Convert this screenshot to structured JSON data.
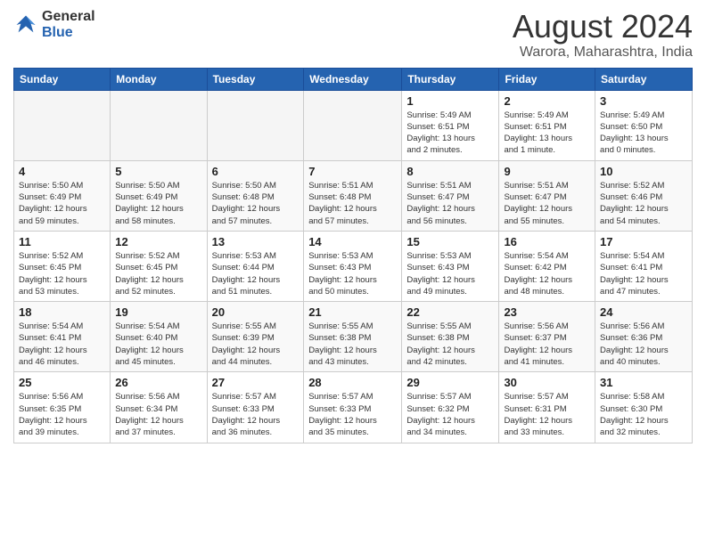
{
  "logo": {
    "line1": "General",
    "line2": "Blue"
  },
  "title": "August 2024",
  "subtitle": "Warora, Maharashtra, India",
  "days_of_week": [
    "Sunday",
    "Monday",
    "Tuesday",
    "Wednesday",
    "Thursday",
    "Friday",
    "Saturday"
  ],
  "weeks": [
    [
      {
        "num": "",
        "info": ""
      },
      {
        "num": "",
        "info": ""
      },
      {
        "num": "",
        "info": ""
      },
      {
        "num": "",
        "info": ""
      },
      {
        "num": "1",
        "info": "Sunrise: 5:49 AM\nSunset: 6:51 PM\nDaylight: 13 hours\nand 2 minutes."
      },
      {
        "num": "2",
        "info": "Sunrise: 5:49 AM\nSunset: 6:51 PM\nDaylight: 13 hours\nand 1 minute."
      },
      {
        "num": "3",
        "info": "Sunrise: 5:49 AM\nSunset: 6:50 PM\nDaylight: 13 hours\nand 0 minutes."
      }
    ],
    [
      {
        "num": "4",
        "info": "Sunrise: 5:50 AM\nSunset: 6:49 PM\nDaylight: 12 hours\nand 59 minutes."
      },
      {
        "num": "5",
        "info": "Sunrise: 5:50 AM\nSunset: 6:49 PM\nDaylight: 12 hours\nand 58 minutes."
      },
      {
        "num": "6",
        "info": "Sunrise: 5:50 AM\nSunset: 6:48 PM\nDaylight: 12 hours\nand 57 minutes."
      },
      {
        "num": "7",
        "info": "Sunrise: 5:51 AM\nSunset: 6:48 PM\nDaylight: 12 hours\nand 57 minutes."
      },
      {
        "num": "8",
        "info": "Sunrise: 5:51 AM\nSunset: 6:47 PM\nDaylight: 12 hours\nand 56 minutes."
      },
      {
        "num": "9",
        "info": "Sunrise: 5:51 AM\nSunset: 6:47 PM\nDaylight: 12 hours\nand 55 minutes."
      },
      {
        "num": "10",
        "info": "Sunrise: 5:52 AM\nSunset: 6:46 PM\nDaylight: 12 hours\nand 54 minutes."
      }
    ],
    [
      {
        "num": "11",
        "info": "Sunrise: 5:52 AM\nSunset: 6:45 PM\nDaylight: 12 hours\nand 53 minutes."
      },
      {
        "num": "12",
        "info": "Sunrise: 5:52 AM\nSunset: 6:45 PM\nDaylight: 12 hours\nand 52 minutes."
      },
      {
        "num": "13",
        "info": "Sunrise: 5:53 AM\nSunset: 6:44 PM\nDaylight: 12 hours\nand 51 minutes."
      },
      {
        "num": "14",
        "info": "Sunrise: 5:53 AM\nSunset: 6:43 PM\nDaylight: 12 hours\nand 50 minutes."
      },
      {
        "num": "15",
        "info": "Sunrise: 5:53 AM\nSunset: 6:43 PM\nDaylight: 12 hours\nand 49 minutes."
      },
      {
        "num": "16",
        "info": "Sunrise: 5:54 AM\nSunset: 6:42 PM\nDaylight: 12 hours\nand 48 minutes."
      },
      {
        "num": "17",
        "info": "Sunrise: 5:54 AM\nSunset: 6:41 PM\nDaylight: 12 hours\nand 47 minutes."
      }
    ],
    [
      {
        "num": "18",
        "info": "Sunrise: 5:54 AM\nSunset: 6:41 PM\nDaylight: 12 hours\nand 46 minutes."
      },
      {
        "num": "19",
        "info": "Sunrise: 5:54 AM\nSunset: 6:40 PM\nDaylight: 12 hours\nand 45 minutes."
      },
      {
        "num": "20",
        "info": "Sunrise: 5:55 AM\nSunset: 6:39 PM\nDaylight: 12 hours\nand 44 minutes."
      },
      {
        "num": "21",
        "info": "Sunrise: 5:55 AM\nSunset: 6:38 PM\nDaylight: 12 hours\nand 43 minutes."
      },
      {
        "num": "22",
        "info": "Sunrise: 5:55 AM\nSunset: 6:38 PM\nDaylight: 12 hours\nand 42 minutes."
      },
      {
        "num": "23",
        "info": "Sunrise: 5:56 AM\nSunset: 6:37 PM\nDaylight: 12 hours\nand 41 minutes."
      },
      {
        "num": "24",
        "info": "Sunrise: 5:56 AM\nSunset: 6:36 PM\nDaylight: 12 hours\nand 40 minutes."
      }
    ],
    [
      {
        "num": "25",
        "info": "Sunrise: 5:56 AM\nSunset: 6:35 PM\nDaylight: 12 hours\nand 39 minutes."
      },
      {
        "num": "26",
        "info": "Sunrise: 5:56 AM\nSunset: 6:34 PM\nDaylight: 12 hours\nand 37 minutes."
      },
      {
        "num": "27",
        "info": "Sunrise: 5:57 AM\nSunset: 6:33 PM\nDaylight: 12 hours\nand 36 minutes."
      },
      {
        "num": "28",
        "info": "Sunrise: 5:57 AM\nSunset: 6:33 PM\nDaylight: 12 hours\nand 35 minutes."
      },
      {
        "num": "29",
        "info": "Sunrise: 5:57 AM\nSunset: 6:32 PM\nDaylight: 12 hours\nand 34 minutes."
      },
      {
        "num": "30",
        "info": "Sunrise: 5:57 AM\nSunset: 6:31 PM\nDaylight: 12 hours\nand 33 minutes."
      },
      {
        "num": "31",
        "info": "Sunrise: 5:58 AM\nSunset: 6:30 PM\nDaylight: 12 hours\nand 32 minutes."
      }
    ]
  ]
}
